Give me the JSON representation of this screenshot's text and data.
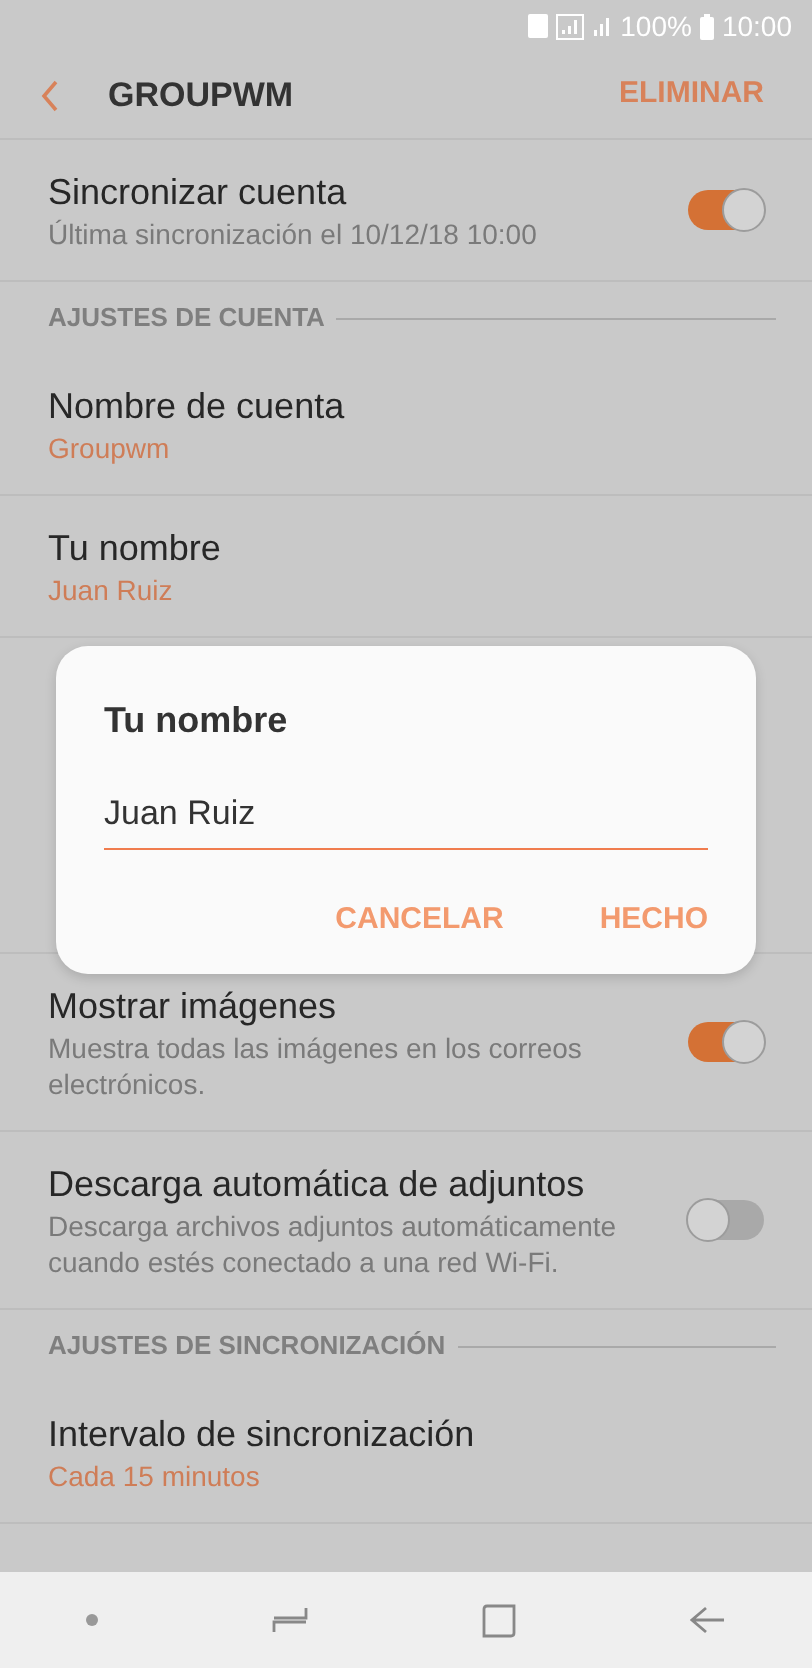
{
  "status_bar": {
    "battery": "100%",
    "time": "10:00"
  },
  "header": {
    "title": "GROUPWM",
    "action": "ELIMINAR"
  },
  "list": [
    {
      "kind": "toggle",
      "title": "Sincronizar cuenta",
      "subtitle": "Última sincronización el 10/12/18  10:00",
      "on": true
    },
    {
      "kind": "section",
      "title": "AJUSTES DE CUENTA"
    },
    {
      "kind": "setting",
      "title": "Nombre de cuenta",
      "value": "Groupwm"
    },
    {
      "kind": "setting",
      "title": "Tu nombre",
      "value": "Juan Ruiz"
    },
    {
      "kind": "toggle",
      "title": "Mostrar imágenes",
      "subtitle": "Muestra todas las imágenes en los correos electrónicos.",
      "on": true
    },
    {
      "kind": "toggle",
      "title": "Descarga automática de adjuntos",
      "subtitle": "Descarga archivos adjuntos automáticamente cuando estés conectado a una red Wi-Fi.",
      "on": false
    },
    {
      "kind": "section",
      "title": "AJUSTES DE SINCRONIZACIÓN"
    },
    {
      "kind": "setting",
      "title": "Intervalo de sincronización",
      "value": "Cada 15 minutos"
    }
  ],
  "dialog": {
    "title": "Tu nombre",
    "value": "Juan Ruiz",
    "buttons": [
      "CANCELAR",
      "HECHO"
    ]
  }
}
